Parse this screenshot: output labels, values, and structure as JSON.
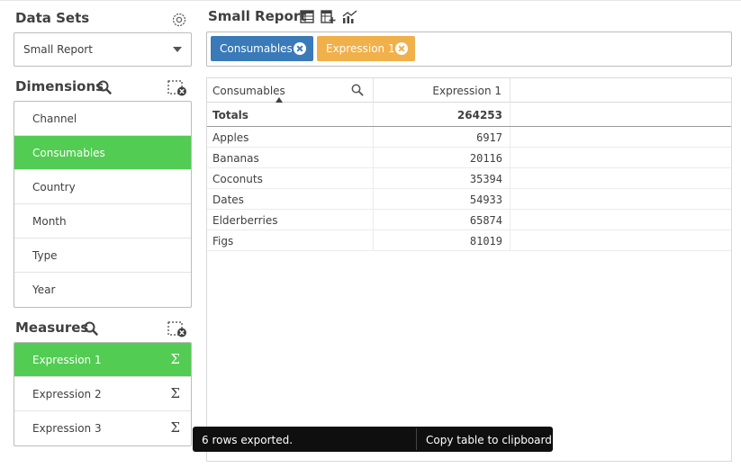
{
  "left": {
    "datasets_title": "Data Sets",
    "dataset_selected": "Small Report",
    "dimensions_title": "Dimensions",
    "dimensions": [
      {
        "label": "Channel",
        "selected": false
      },
      {
        "label": "Consumables",
        "selected": true
      },
      {
        "label": "Country",
        "selected": false
      },
      {
        "label": "Month",
        "selected": false
      },
      {
        "label": "Type",
        "selected": false
      },
      {
        "label": "Year",
        "selected": false
      }
    ],
    "measures_title": "Measures",
    "measures": [
      {
        "label": "Expression 1",
        "selected": true
      },
      {
        "label": "Expression 2",
        "selected": false
      },
      {
        "label": "Expression 3",
        "selected": false
      }
    ],
    "sigma_glyph": "Σ"
  },
  "report": {
    "title": "Small Report",
    "chips": [
      {
        "label": "Consumables",
        "color": "#3a7ab8"
      },
      {
        "label": "Expression 1",
        "color": "#f0b04a"
      }
    ]
  },
  "table": {
    "columns": [
      "Consumables",
      "Expression 1"
    ],
    "totals_label": "Totals",
    "totals_value": "264253",
    "rows": [
      {
        "name": "Apples",
        "value": "6917"
      },
      {
        "name": "Bananas",
        "value": "20116"
      },
      {
        "name": "Coconuts",
        "value": "35394"
      },
      {
        "name": "Dates",
        "value": "54933"
      },
      {
        "name": "Elderberries",
        "value": "65874"
      },
      {
        "name": "Figs",
        "value": "81019"
      }
    ]
  },
  "toast": {
    "message": "6 rows exported.",
    "action": "Copy table to clipboard"
  },
  "colors": {
    "selected_green": "#52cc52",
    "chip_blue": "#3a7ab8",
    "chip_orange": "#f0b04a"
  }
}
